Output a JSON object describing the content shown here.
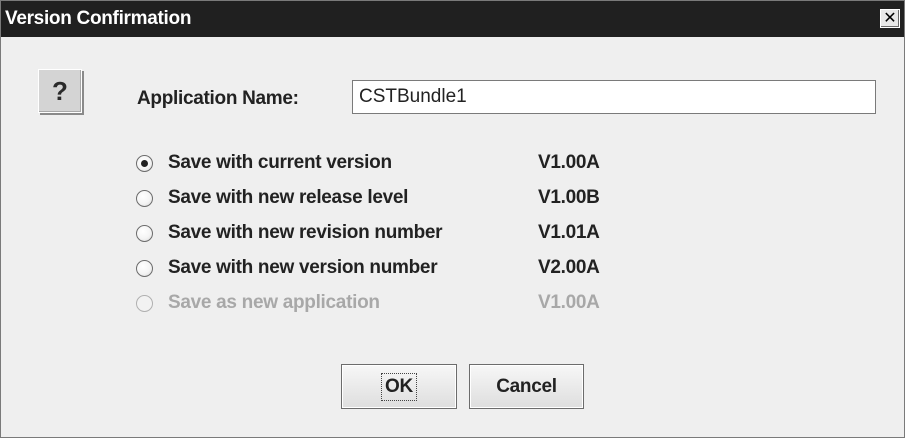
{
  "window": {
    "title": "Version Confirmation",
    "close_symbol": "✕"
  },
  "icon": {
    "name": "question-icon",
    "glyph": "?"
  },
  "application": {
    "label": "Application Name:",
    "value": "CSTBundle1"
  },
  "options": [
    {
      "label": "Save with current version",
      "version": "V1.00A",
      "selected": true,
      "enabled": true
    },
    {
      "label": "Save with new release level",
      "version": "V1.00B",
      "selected": false,
      "enabled": true
    },
    {
      "label": "Save with new revision number",
      "version": "V1.01A",
      "selected": false,
      "enabled": true
    },
    {
      "label": "Save with new version number",
      "version": "V2.00A",
      "selected": false,
      "enabled": true
    },
    {
      "label": "Save as new application",
      "version": "V1.00A",
      "selected": false,
      "enabled": false
    }
  ],
  "buttons": {
    "ok_label": "OK",
    "cancel_label": "Cancel"
  },
  "colors": {
    "titlebar": "#202020",
    "dialog_bg": "#efefef",
    "disabled_text": "#a8a8a8"
  }
}
